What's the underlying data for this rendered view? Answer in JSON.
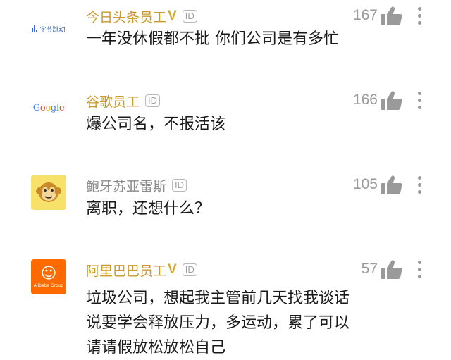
{
  "comments": [
    {
      "author": "今日头条员工",
      "verified_mark": "V",
      "id_badge": "ID",
      "likes": "167",
      "text_lines": [
        "一年没休假都不批 你们公司是有多忙"
      ],
      "avatar": "bytedance-logo",
      "avatar_text": "字节跳动"
    },
    {
      "author": "谷歌员工",
      "id_badge": "ID",
      "likes": "166",
      "text_lines": [
        "爆公司名，不报活该"
      ],
      "avatar": "google-logo",
      "avatar_letters": [
        "G",
        "o",
        "o",
        "g",
        "l",
        "e"
      ]
    },
    {
      "author": "鲍牙苏亚雷斯",
      "id_badge": "ID",
      "likes": "105",
      "text_lines": [
        "离职，还想什么？"
      ],
      "avatar": "monkey-avatar"
    },
    {
      "author": "阿里巴巴员工",
      "verified_mark": "V",
      "id_badge": "ID",
      "likes": "57",
      "text_lines": [
        "垃圾公司，想起我主管前几天找我谈话",
        "说要学会释放压力，多运动，累了可以",
        "请请假放松放松自己"
      ],
      "avatar": "alibaba-logo",
      "avatar_mark": "☺",
      "avatar_text": "Alibaba Group"
    }
  ],
  "colors": {
    "gold_name": "#c99a2e",
    "gray_name": "#8a8a8a",
    "google_blue": "#4285f4",
    "google_red": "#ea4335",
    "google_yellow": "#fbbc05",
    "google_green": "#34a853",
    "alibaba_orange": "#ff6a00",
    "bytedance_blue": "#3c6ad6"
  }
}
